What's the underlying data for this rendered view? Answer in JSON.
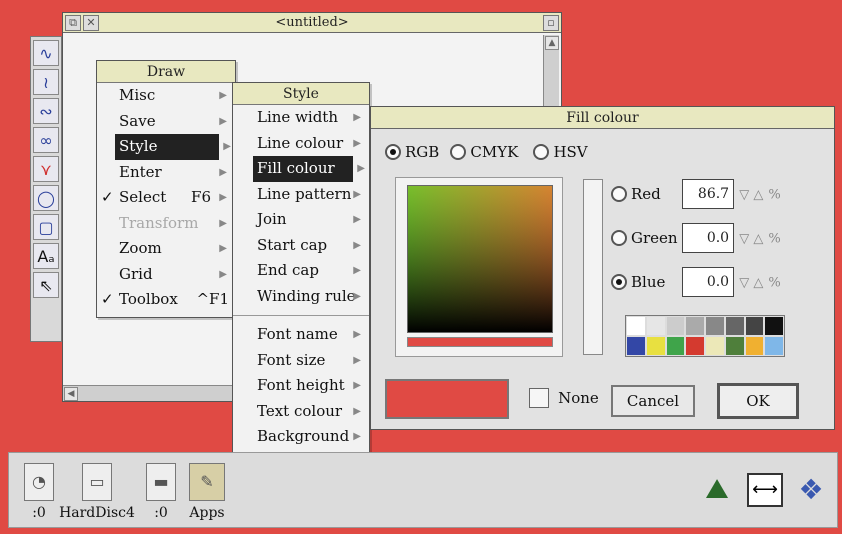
{
  "draw_window": {
    "title": "<untitled>"
  },
  "toolbox": {
    "tools": [
      "freehand-line-tool",
      "curve-tool",
      "line-tool",
      "closed-curve-tool",
      "freehand-tool",
      "ellipse-tool",
      "rectangle-tool",
      "text-tool",
      "select-tool"
    ]
  },
  "draw_menu": {
    "title": "Draw",
    "items": [
      {
        "label": "Misc",
        "arrow": "▶"
      },
      {
        "label": "Save",
        "arrow": "▶"
      },
      {
        "label": "Style",
        "arrow": "▶"
      },
      {
        "label": "Enter",
        "arrow": "▶"
      },
      {
        "label": "Select",
        "tick": "✓",
        "shortcut": "F6",
        "arrow": "▶"
      },
      {
        "label": "Transform",
        "arrow": "▶"
      },
      {
        "label": "Zoom",
        "arrow": "▶"
      },
      {
        "label": "Grid",
        "arrow": "▶"
      },
      {
        "label": "Toolbox",
        "tick": "✓",
        "shortcut": "^F1"
      }
    ]
  },
  "style_menu": {
    "title": "Style",
    "items": [
      "Line width",
      "Line colour",
      "Fill colour",
      "Line pattern",
      "Join",
      "Start cap",
      "End cap",
      "Winding rule"
    ],
    "font_items": [
      "Font name",
      "Font size",
      "Font height",
      "Text colour",
      "Background"
    ],
    "arrow": "▶"
  },
  "fill_dialog": {
    "title": "Fill colour",
    "models": [
      "RGB",
      "CMYK",
      "HSV"
    ],
    "channels": [
      {
        "label": "Red",
        "value": "86.7"
      },
      {
        "label": "Green",
        "value": "0.0"
      },
      {
        "label": "Blue",
        "value": "0.0"
      }
    ],
    "unit": "%",
    "none_label": "None",
    "cancel_label": "Cancel",
    "ok_label": "OK",
    "palette": [
      "#ffffff",
      "#e6e6e6",
      "#cccccc",
      "#aaaaaa",
      "#888888",
      "#666666",
      "#444444",
      "#111111",
      "#3347a6",
      "#e8e040",
      "#3fa44a",
      "#d43a2f",
      "#ece8b8",
      "#4f7f3b",
      "#f0b030",
      "#7fb7e8"
    ],
    "selected_colour": "#e04a44"
  },
  "iconbar": {
    "items": [
      {
        "label": ":0",
        "icon": "floppy-drive-icon"
      },
      {
        "label": "HardDisc4",
        "icon": "hard-disc-icon"
      },
      {
        "label": ":0",
        "icon": "ram-disc-icon"
      },
      {
        "label": "Apps",
        "icon": "apps-folder-icon"
      }
    ]
  }
}
